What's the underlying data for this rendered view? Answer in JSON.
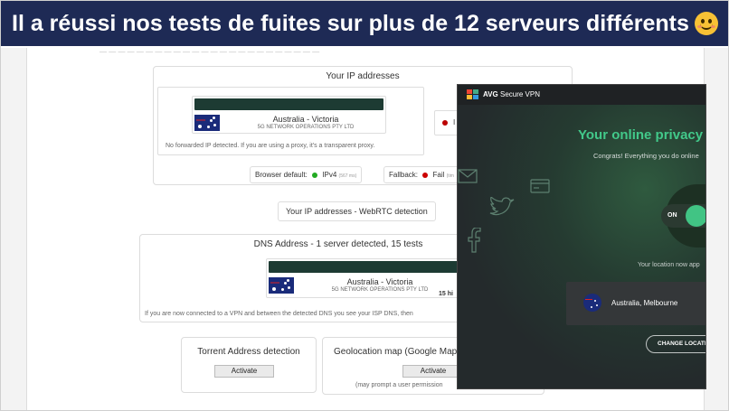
{
  "banner": {
    "caption": "Il a réussi nos tests de fuites sur plus de 12 serveurs différents",
    "emoji": "smiling-face-emoji"
  },
  "leak_test": {
    "ip_section": {
      "title": "Your IP addresses",
      "location": "Australia - Victoria",
      "isp": "5G NETWORK OPERATIONS PTY LTD",
      "note": "No forwarded IP detected. If you are using a proxy, it's a transparent proxy.",
      "browser_default_label": "Browser default:",
      "browser_default_protocol": "IPv4",
      "browser_default_ms": "(567 ms)",
      "fallback_label": "Fallback:",
      "fallback_status": "Fail",
      "fallback_ms": "(tim",
      "side_status_letter": "I"
    },
    "webrtc_button": "Your IP addresses - WebRTC detection",
    "dns_section": {
      "title": "DNS Address - 1 server detected, 15 tests",
      "location": "Australia - Victoria",
      "isp": "5G NETWORK OPERATIONS PTY LTD",
      "hits": "15 hi",
      "note": "If you are now connected to a VPN and between the detected DNS you see your ISP DNS, then"
    },
    "torrent": {
      "title": "Torrent Address detection",
      "button": "Activate"
    },
    "geolocation": {
      "title": "Geolocation map (Google Map",
      "button": "Activate",
      "note": "(may prompt a user permission"
    }
  },
  "vpn_app": {
    "brand": "AVG",
    "app_name": "Secure VPN",
    "headline": "Your online privacy",
    "congrats": "Congrats! Everything you do online",
    "toggle_label": "ON",
    "location_label": "Your location now app",
    "location_name": "Australia, Melbourne",
    "change_button": "CHANGE LOCATIO",
    "colors": {
      "accent": "#42c98a",
      "background": "#2b2f31"
    },
    "icons": [
      "envelope-icon",
      "twitter-bird-icon",
      "facebook-icon",
      "credit-card-icon"
    ]
  }
}
